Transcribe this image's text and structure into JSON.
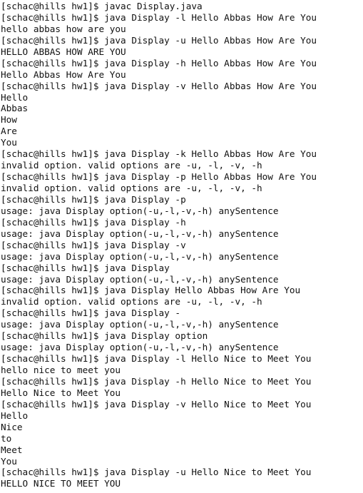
{
  "terminal": {
    "lines": [
      "[schac@hills hw1]$ javac Display.java",
      "[schac@hills hw1]$ java Display -l Hello Abbas How Are You",
      "hello abbas how are you",
      "[schac@hills hw1]$ java Display -u Hello Abbas How Are You",
      "HELLO ABBAS HOW ARE YOU",
      "[schac@hills hw1]$ java Display -h Hello Abbas How Are You",
      "Hello Abbas How Are You",
      "[schac@hills hw1]$ java Display -v Hello Abbas How Are You",
      "Hello",
      "Abbas",
      "How",
      "Are",
      "You",
      "[schac@hills hw1]$ java Display -k Hello Abbas How Are You",
      "invalid option. valid options are -u, -l, -v, -h",
      "[schac@hills hw1]$ java Display -p Hello Abbas How Are You",
      "invalid option. valid options are -u, -l, -v, -h",
      "[schac@hills hw1]$ java Display -p",
      "usage: java Display option(-u,-l,-v,-h) anySentence",
      "[schac@hills hw1]$ java Display -h",
      "usage: java Display option(-u,-l,-v,-h) anySentence",
      "[schac@hills hw1]$ java Display -v",
      "usage: java Display option(-u,-l,-v,-h) anySentence",
      "[schac@hills hw1]$ java Display",
      "usage: java Display option(-u,-l,-v,-h) anySentence",
      "[schac@hills hw1]$ java Display Hello Abbas How Are You",
      "invalid option. valid options are -u, -l, -v, -h",
      "[schac@hills hw1]$ java Display -",
      "usage: java Display option(-u,-l,-v,-h) anySentence",
      "[schac@hills hw1]$ java Display option",
      "usage: java Display option(-u,-l,-v,-h) anySentence",
      "[schac@hills hw1]$ java Display -l Hello Nice to Meet You",
      "hello nice to meet you",
      "[schac@hills hw1]$ java Display -h Hello Nice to Meet You",
      "Hello Nice to Meet You",
      "[schac@hills hw1]$ java Display -v Hello Nice to Meet You",
      "Hello",
      "Nice",
      "to",
      "Meet",
      "You",
      "[schac@hills hw1]$ java Display -u Hello Nice to Meet You",
      "HELLO NICE TO MEET YOU"
    ]
  }
}
